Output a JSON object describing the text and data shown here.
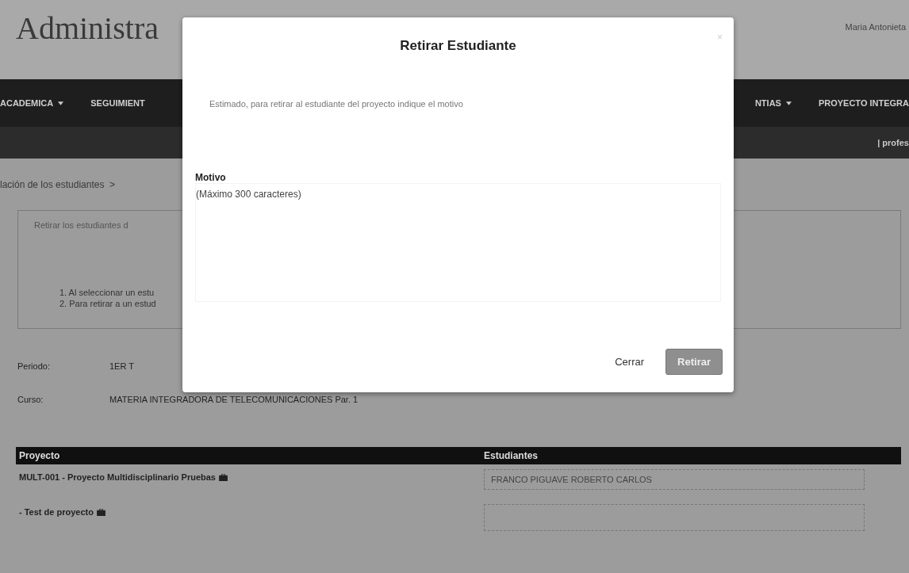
{
  "header": {
    "title": "Administra",
    "user": "Maria Antonieta"
  },
  "nav": {
    "left": [
      {
        "label": "ACADEMICA",
        "dropdown": true
      },
      {
        "label": "SEGUIMIENT",
        "dropdown": false
      }
    ],
    "right": [
      {
        "label": "NTIAS",
        "dropdown": true
      },
      {
        "label": "PROYECTO INTEGRA",
        "dropdown": false
      }
    ]
  },
  "subbar": {
    "text": "| profes"
  },
  "breadcrumb": "lación de los estudiantes  >",
  "info_panel": {
    "heading": "Retirar los estudiantes d",
    "steps": [
      "1. Al seleccionar un estu",
      "2. Para retirar a un estud"
    ]
  },
  "fields": [
    {
      "label": "Periodo:",
      "value": "1ER T"
    },
    {
      "label": "Curso:",
      "value": "MATERIA INTEGRADORA DE TELECOMUNICACIONES Par. 1"
    }
  ],
  "table": {
    "columns": [
      "Proyecto",
      "Estudiantes"
    ],
    "rows": [
      {
        "project": "MULT-001 - Proyecto Multidisciplinario Pruebas",
        "student": "FRANCO PIGUAVE ROBERTO CARLOS"
      },
      {
        "project": "- Test de proyecto"
      }
    ]
  },
  "modal": {
    "title": "Retirar Estudiante",
    "close": "×",
    "message": "Estimado, para retirar al estudiante del proyecto indique el motivo",
    "field_label": "Motivo",
    "placeholder": "(Máximo 300 caracteres)",
    "buttons": [
      {
        "label": "Cerrar",
        "kind": "link",
        "disabled": false
      },
      {
        "label": "Retirar",
        "kind": "primary",
        "disabled": true
      }
    ]
  }
}
